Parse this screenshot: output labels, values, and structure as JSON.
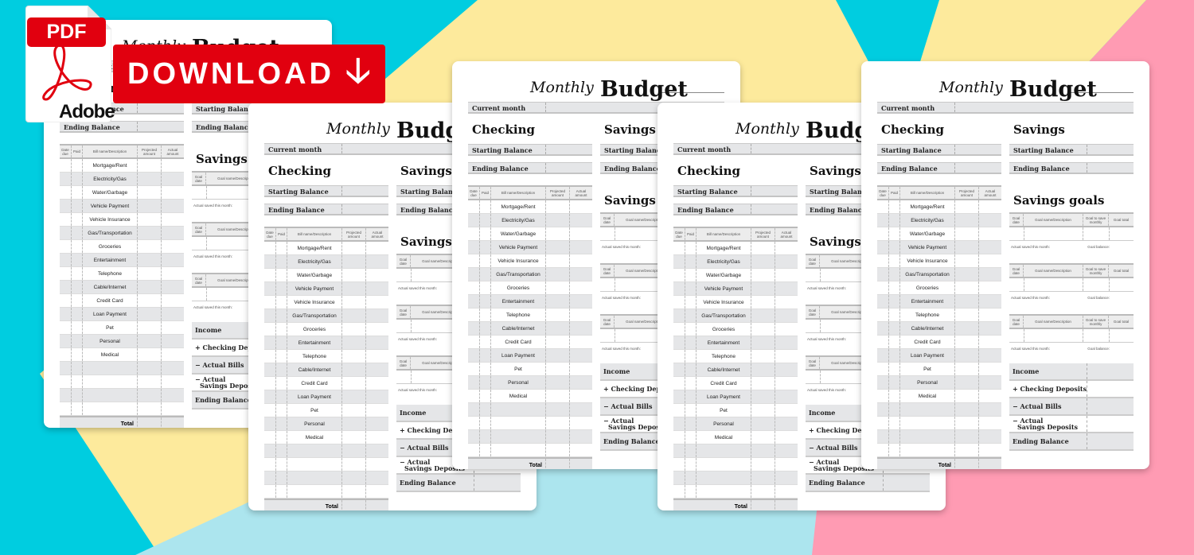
{
  "banner": {
    "pdf_tag": "PDF",
    "brand": "Adobe",
    "download_label": "DOWNLOAD",
    "download_icon": "arrow-down-icon",
    "accent_color": "#e1000f"
  },
  "background": {
    "colors": [
      "#00cde0",
      "#fdea9c",
      "#ace5ee",
      "#ff9bb3"
    ]
  },
  "sheet": {
    "title_script": "Monthly",
    "title_bold": "Budget",
    "current_month_label": "Current month",
    "checking_heading": "Checking",
    "savings_heading": "Savings",
    "starting_balance": "Starting Balance",
    "ending_balance": "Ending Balance",
    "bills_columns": [
      "Date due",
      "Paid",
      "Bill name/Description",
      "Projected amount",
      "Actual amount"
    ],
    "bills": [
      "Mortgage/Rent",
      "Electricity/Gas",
      "Water/Garbage",
      "Vehicle Payment",
      "Vehicle Insurance",
      "Gas/Transportation",
      "Groceries",
      "Entertainment",
      "Telephone",
      "Cable/Internet",
      "Credit Card",
      "Loan Payment",
      "Pet",
      "Personal",
      "Medical",
      "",
      "",
      "",
      ""
    ],
    "total_label": "Total",
    "savings_goals_heading": "Savings goals",
    "goal_columns": [
      "Goal date",
      "Goal name/Description",
      "Goal to save monthly",
      "Goal total"
    ],
    "actual_saved_label": "Actual saved this month:",
    "goal_balance_label": "Goal balance:",
    "summary": {
      "income": "Income",
      "checking_deposits": "+ Checking Deposits",
      "actual_bills": "− Actual Bills",
      "actual_savings_1": "− Actual",
      "actual_savings_2": "Savings Deposits",
      "ending_balance": "Ending Balance"
    }
  }
}
